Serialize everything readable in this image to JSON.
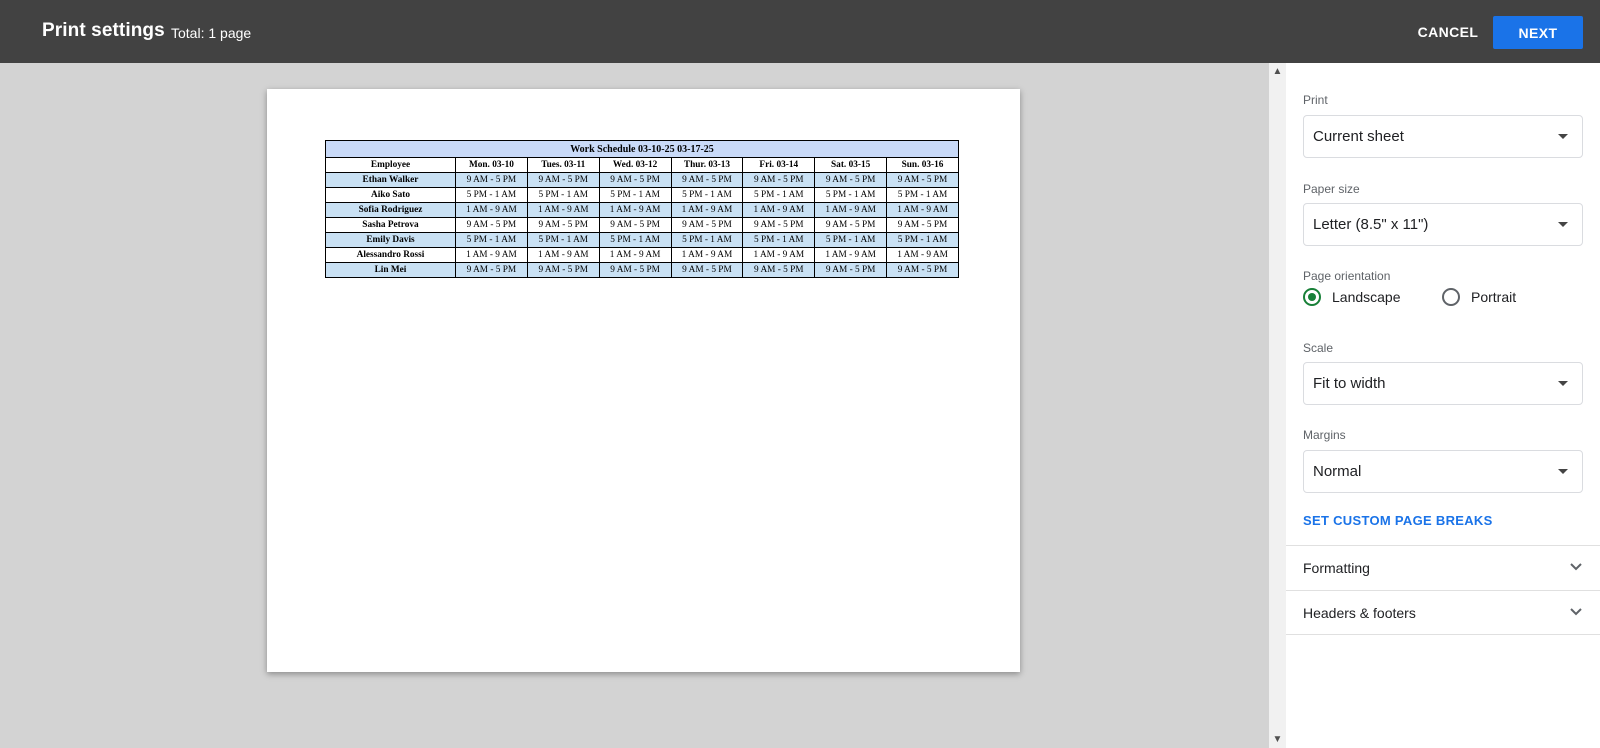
{
  "header": {
    "title": "Print settings",
    "total": "Total: 1 page",
    "cancel_label": "CANCEL",
    "next_label": "NEXT"
  },
  "preview": {
    "table": {
      "title": "Work Schedule 03-10-25 03-17-25",
      "columns": [
        "Employee",
        "Mon. 03-10",
        "Tues. 03-11",
        "Wed. 03-12",
        "Thur. 03-13",
        "Fri. 03-14",
        "Sat. 03-15",
        "Sun. 03-16"
      ],
      "rows": [
        [
          "Ethan Walker",
          "9 AM - 5 PM",
          "9 AM - 5 PM",
          "9 AM - 5 PM",
          "9 AM - 5 PM",
          "9 AM - 5 PM",
          "9 AM - 5 PM",
          "9 AM - 5 PM"
        ],
        [
          "Aiko Sato",
          "5 PM - 1 AM",
          "5 PM - 1 AM",
          "5 PM - 1 AM",
          "5 PM - 1 AM",
          "5 PM - 1 AM",
          "5 PM - 1 AM",
          "5 PM - 1 AM"
        ],
        [
          "Sofia Rodriguez",
          "1 AM - 9 AM",
          "1 AM - 9 AM",
          "1 AM - 9 AM",
          "1 AM - 9 AM",
          "1 AM - 9 AM",
          "1 AM - 9 AM",
          "1 AM - 9 AM"
        ],
        [
          "Sasha Petrova",
          "9 AM - 5 PM",
          "9 AM - 5 PM",
          "9 AM - 5 PM",
          "9 AM - 5 PM",
          "9 AM - 5 PM",
          "9 AM - 5 PM",
          "9 AM - 5 PM"
        ],
        [
          "Emily Davis",
          "5 PM - 1 AM",
          "5 PM - 1 AM",
          "5 PM - 1 AM",
          "5 PM - 1 AM",
          "5 PM - 1 AM",
          "5 PM - 1 AM",
          "5 PM - 1 AM"
        ],
        [
          "Alessandro Rossi",
          "1 AM - 9 AM",
          "1 AM - 9 AM",
          "1 AM - 9 AM",
          "1 AM - 9 AM",
          "1 AM - 9 AM",
          "1 AM - 9 AM",
          "1 AM - 9 AM"
        ],
        [
          "Lin Mei",
          "9 AM - 5 PM",
          "9 AM - 5 PM",
          "9 AM - 5 PM",
          "9 AM - 5 PM",
          "9 AM - 5 PM",
          "9 AM - 5 PM",
          "9 AM - 5 PM"
        ]
      ],
      "row_fill": "#c9e1f4",
      "title_fill": "#c9daf8"
    }
  },
  "settings": {
    "print": {
      "label": "Print",
      "value": "Current sheet"
    },
    "paper_size": {
      "label": "Paper size",
      "value": "Letter (8.5\" x 11\")"
    },
    "orientation": {
      "label": "Page orientation",
      "options": [
        "Landscape",
        "Portrait"
      ],
      "selected": "Landscape"
    },
    "scale": {
      "label": "Scale",
      "value": "Fit to width"
    },
    "margins": {
      "label": "Margins",
      "value": "Normal"
    },
    "custom_breaks_label": "SET CUSTOM PAGE BREAKS",
    "sections": [
      "Formatting",
      "Headers & footers"
    ]
  },
  "colors": {
    "topbar": "#424242",
    "accent": "#1a73e8",
    "radio_checked": "#188038"
  },
  "icons": [
    "chevron-up-icon",
    "chevron-down-icon",
    "dropdown-caret-icon",
    "expand-chevron-icon"
  ]
}
